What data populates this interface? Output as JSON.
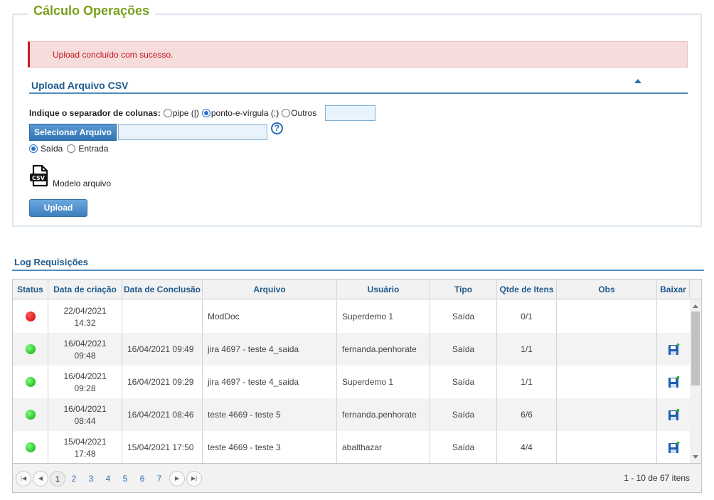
{
  "panel": {
    "title": "Cálculo Operações"
  },
  "alert": {
    "message": "Upload concluído com sucesso."
  },
  "upload": {
    "section_title": "Upload Arquivo CSV",
    "separator_label": "Indique o separador de colunas:",
    "separator_options": [
      {
        "label": "pipe (|)",
        "checked": false
      },
      {
        "label": "ponto-e-vírgula (;)",
        "checked": true
      },
      {
        "label": "Outros",
        "checked": false
      }
    ],
    "other_value": "",
    "select_file_label": "Selecionar Arquivo",
    "file_value": "",
    "help_icon": "question-circle-icon",
    "direction_options": [
      {
        "label": "Saída",
        "checked": true
      },
      {
        "label": "Entrada",
        "checked": false
      }
    ],
    "model_label": "Modelo arquivo",
    "model_icon": "csv-file-icon",
    "upload_label": "Upload"
  },
  "log": {
    "title": "Log Requisições",
    "columns": [
      "Status",
      "Data de criação",
      "Data de Conclusão",
      "Arquivo",
      "Usuário",
      "Tipo",
      "Qtde de Itens",
      "Obs",
      "Baixar"
    ],
    "rows": [
      {
        "status": "red",
        "created_date": "22/04/2021",
        "created_time": "14:32",
        "completed": "",
        "file": "ModDoc",
        "user": "Superdemo 1",
        "type": "Saída",
        "qty": "0/1",
        "obs": "",
        "download": false
      },
      {
        "status": "green",
        "created_date": "16/04/2021",
        "created_time": "09:48",
        "completed": "16/04/2021 09:49",
        "file": "jira 4697 - teste 4_saida",
        "user": "fernanda.penhorate",
        "type": "Saída",
        "qty": "1/1",
        "obs": "",
        "download": true
      },
      {
        "status": "green",
        "created_date": "16/04/2021",
        "created_time": "09:28",
        "completed": "16/04/2021 09:29",
        "file": "jira 4697 - teste 4_saida",
        "user": "Superdemo 1",
        "type": "Saída",
        "qty": "1/1",
        "obs": "",
        "download": true
      },
      {
        "status": "green",
        "created_date": "16/04/2021",
        "created_time": "08:44",
        "completed": "16/04/2021 08:46",
        "file": "teste 4669 - teste 5",
        "user": "fernanda.penhorate",
        "type": "Saída",
        "qty": "6/6",
        "obs": "",
        "download": true
      },
      {
        "status": "green",
        "created_date": "15/04/2021",
        "created_time": "17:48",
        "completed": "15/04/2021 17:50",
        "file": "teste 4669 - teste 3",
        "user": "abalthazar",
        "type": "Saída",
        "qty": "4/4",
        "obs": "",
        "download": true
      }
    ],
    "pager": {
      "pages": [
        "1",
        "2",
        "3",
        "4",
        "5",
        "6",
        "7"
      ],
      "current": "1",
      "info": "1 - 10 de 67 itens"
    }
  },
  "colors": {
    "accent": "#7aa01a",
    "link": "#1f5a8c",
    "alert_bg": "#f7dcdd",
    "alert_text": "#c0141c"
  }
}
